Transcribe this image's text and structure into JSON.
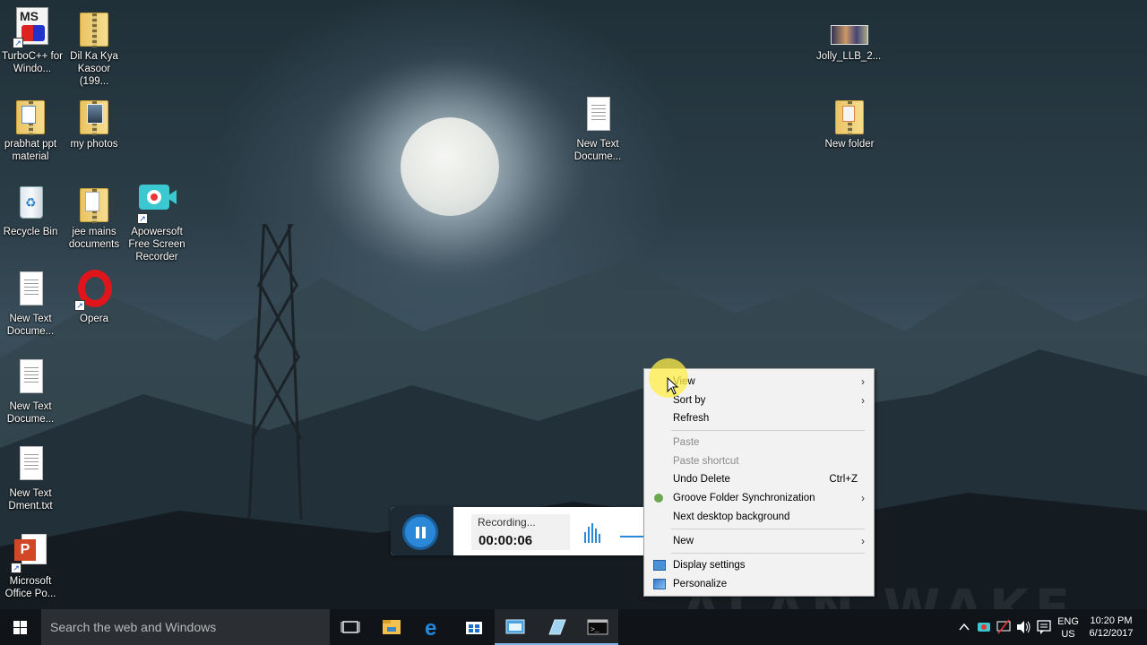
{
  "desktop": {
    "icons": [
      {
        "label": "TurboC++ for Windo...",
        "icon": "turbocpp-icon"
      },
      {
        "label": "Dil Ka Kya Kasoor (199...",
        "icon": "zip-folder-icon"
      },
      {
        "label": "prabhat ppt material",
        "icon": "folder-icon"
      },
      {
        "label": "my photos",
        "icon": "folder-icon"
      },
      {
        "label": "Recycle Bin",
        "icon": "recycle-bin-icon"
      },
      {
        "label": "jee mains documents",
        "icon": "folder-icon"
      },
      {
        "label": "Apowersoft Free Screen Recorder",
        "icon": "screen-recorder-icon"
      },
      {
        "label": "New Text Docume...",
        "icon": "text-document-icon"
      },
      {
        "label": "Opera",
        "icon": "opera-icon"
      },
      {
        "label": "New Text Docume...",
        "icon": "text-document-icon"
      },
      {
        "label": "New Text Dment.txt",
        "icon": "text-document-icon"
      },
      {
        "label": "Microsoft Office Po...",
        "icon": "powerpoint-icon"
      },
      {
        "label": "New Text Docume...",
        "icon": "text-document-icon"
      },
      {
        "label": "Jolly_LLB_2...",
        "icon": "video-file-icon"
      },
      {
        "label": "New folder",
        "icon": "folder-icon"
      }
    ]
  },
  "recorder": {
    "status": "Recording...",
    "time": "00:00:06"
  },
  "context_menu": {
    "items": [
      {
        "label": "View",
        "submenu": true,
        "disabled": false
      },
      {
        "label": "Sort by",
        "submenu": true,
        "disabled": false
      },
      {
        "label": "Refresh",
        "submenu": false,
        "disabled": false
      },
      {
        "label": "Paste",
        "submenu": false,
        "disabled": true
      },
      {
        "label": "Paste shortcut",
        "submenu": false,
        "disabled": true
      },
      {
        "label": "Undo Delete",
        "shortcut": "Ctrl+Z",
        "submenu": false,
        "disabled": false
      },
      {
        "label": "Groove Folder Synchronization",
        "submenu": true,
        "disabled": false
      },
      {
        "label": "Next desktop background",
        "submenu": false,
        "disabled": false
      },
      {
        "label": "New",
        "submenu": true,
        "disabled": false
      },
      {
        "label": "Display settings",
        "submenu": false,
        "disabled": false
      },
      {
        "label": "Personalize",
        "submenu": false,
        "disabled": false
      }
    ],
    "arrow_glyph": "›"
  },
  "taskbar": {
    "search_placeholder": "Search the web and Windows",
    "pinned": [
      "task-view-icon",
      "file-explorer-icon",
      "edge-icon",
      "store-icon",
      "window-app-icon",
      "notepad-app-icon",
      "cmd-icon"
    ],
    "language": "ENG",
    "region": "US",
    "time": "10:20 PM",
    "date": "6/12/2017"
  },
  "wallpaper_text": "ALAN WAKE"
}
